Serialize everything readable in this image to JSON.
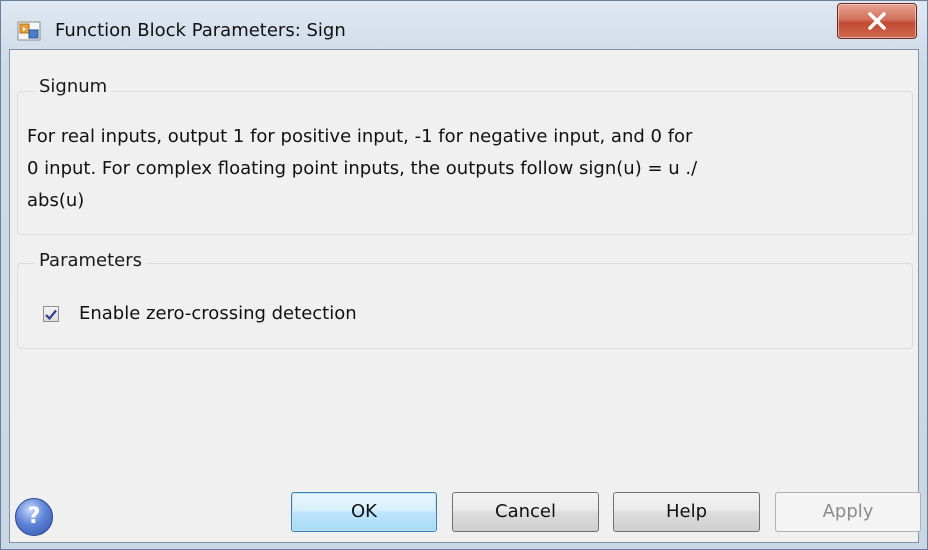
{
  "window": {
    "title": "Function Block Parameters: Sign"
  },
  "signum_group": {
    "label": "Signum",
    "description": "For real inputs, output 1 for positive input, -1 for negative input, and 0 for\n0 input.  For complex floating point inputs, the outputs follow sign(u) = u ./\nabs(u)"
  },
  "parameters_group": {
    "label": "Parameters",
    "zero_crossing": {
      "label": "Enable zero-crossing detection",
      "checked": true
    }
  },
  "buttons": {
    "ok": "OK",
    "cancel": "Cancel",
    "help": "Help",
    "apply": "Apply"
  },
  "icons": {
    "app": "simulink-block-icon",
    "close": "close-icon",
    "help": "help-icon"
  },
  "colors": {
    "close_button": "#c9523b",
    "default_button_border": "#3c7fb1",
    "help_icon": "#3a5fbf"
  }
}
